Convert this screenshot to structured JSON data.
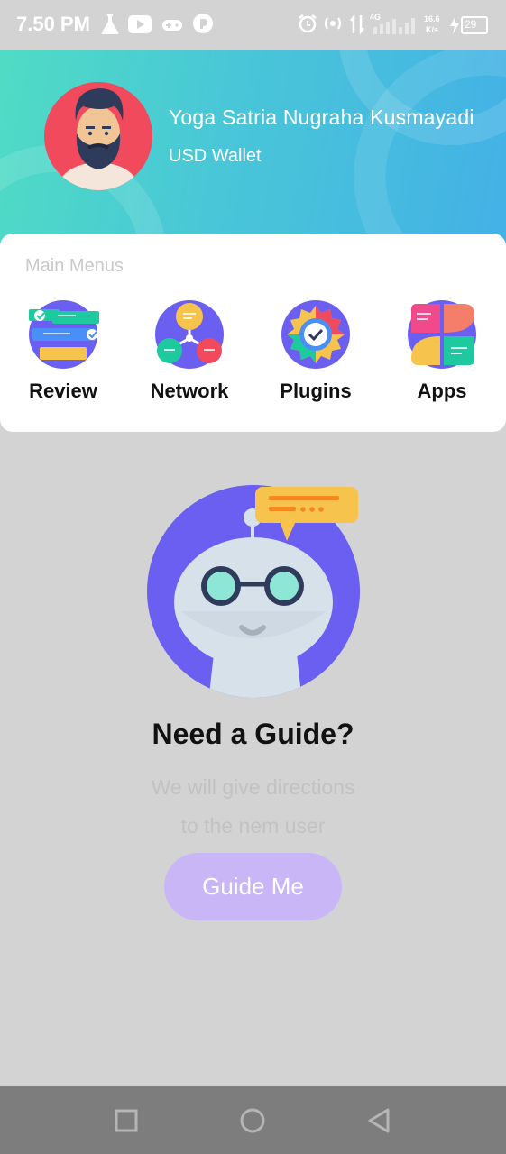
{
  "status_bar": {
    "time": "7.50 PM",
    "speed_value": "16.6",
    "speed_unit": "K/s",
    "network_type": "4G",
    "battery": "29",
    "icons": [
      "flask-icon",
      "youtube-icon",
      "gamepad-icon",
      "app-icon",
      "alarm-icon",
      "hotspot-icon",
      "data-transfer-icon",
      "signal-icon",
      "charging-icon",
      "battery-icon"
    ]
  },
  "header": {
    "user_name": "Yoga Satria Nugraha Kusmayadi",
    "wallet_label": "USD Wallet",
    "colors": {
      "gradient_start": "#4fdcc4",
      "gradient_end": "#43b1e6"
    }
  },
  "main_menus": {
    "title": "Main Menus",
    "items": [
      {
        "label": "Review",
        "icon": "review-icon"
      },
      {
        "label": "Network",
        "icon": "network-icon"
      },
      {
        "label": "Plugins",
        "icon": "plugins-icon"
      },
      {
        "label": "Apps",
        "icon": "apps-icon"
      }
    ]
  },
  "guide": {
    "title": "Need a Guide?",
    "description_line1": "We will give directions",
    "description_line2": "to the nem user",
    "button_label": "Guide Me",
    "colors": {
      "button": "#c9b6f7",
      "illustration_circle": "#6a5ff0"
    }
  },
  "nav_bar": {
    "buttons": [
      "recent-apps-button",
      "home-button",
      "back-button"
    ]
  }
}
